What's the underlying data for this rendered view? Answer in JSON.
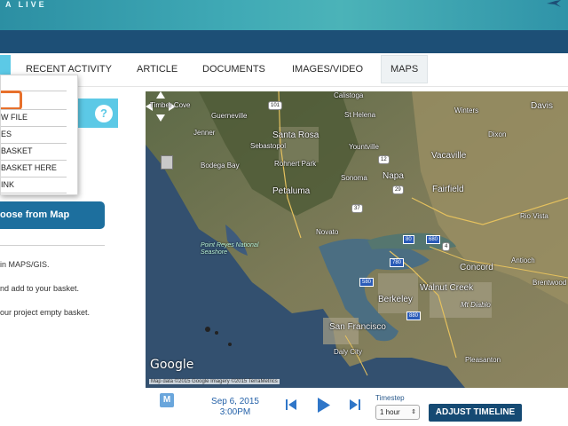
{
  "header": {
    "brand_text": "A LIVE",
    "colors": {
      "bar_start": "#2c8fa3",
      "bar_end": "#2f93a8",
      "band": "#1d4f76"
    }
  },
  "nav": {
    "tabs": [
      {
        "label": "RECENT ACTIVITY"
      },
      {
        "label": "ARTICLE"
      },
      {
        "label": "DOCUMENTS"
      },
      {
        "label": "IMAGES/VIDEO"
      },
      {
        "label": "MAPS",
        "active": true
      }
    ],
    "accent_color": "#5cc9e6"
  },
  "dropdown": {
    "items": [
      {
        "label": ""
      },
      {
        "label": "W FILE"
      },
      {
        "label": "ES"
      },
      {
        "label": "BASKET"
      },
      {
        "label": "BASKET HERE"
      },
      {
        "label": "INK"
      }
    ],
    "highlight_color": "#e7702b"
  },
  "left_panel": {
    "help_label": "?",
    "choose_button": "oose from Map",
    "info_lines": [
      "in MAPS/GIS.",
      "nd add to your basket.",
      "our project empty basket."
    ]
  },
  "map": {
    "places": [
      {
        "name": "Timber Cove"
      },
      {
        "name": "Calistoga"
      },
      {
        "name": "Guerneville"
      },
      {
        "name": "St Helena"
      },
      {
        "name": "Winters"
      },
      {
        "name": "Davis"
      },
      {
        "name": "Jenner"
      },
      {
        "name": "Santa Rosa"
      },
      {
        "name": "Sebastopol"
      },
      {
        "name": "Yountville"
      },
      {
        "name": "Vacaville"
      },
      {
        "name": "Dixon"
      },
      {
        "name": "Bodega Bay"
      },
      {
        "name": "Rohnert Park"
      },
      {
        "name": "Sonoma"
      },
      {
        "name": "Napa"
      },
      {
        "name": "Fairfield"
      },
      {
        "name": "Petaluma"
      },
      {
        "name": "Rio Vista"
      },
      {
        "name": "Novato"
      },
      {
        "name": "Point Reyes National Seashore"
      },
      {
        "name": "Concord"
      },
      {
        "name": "Antioch"
      },
      {
        "name": "Walnut Creek"
      },
      {
        "name": "Brentwood"
      },
      {
        "name": "Berkeley"
      },
      {
        "name": "Mt Diablo"
      },
      {
        "name": "San Francisco"
      },
      {
        "name": "Daly City"
      },
      {
        "name": "Pleasanton"
      }
    ],
    "routes": [
      "101",
      "29",
      "12",
      "37",
      "80",
      "780",
      "680",
      "580",
      "880",
      "4"
    ],
    "google_label": "Google",
    "attribution": "Map data ©2015 Google Imagery ©2015 TerraMetrics",
    "icons": [
      "pan-icon",
      "pegman-icon"
    ]
  },
  "timeline": {
    "m_label": "M",
    "date": "Sep 6, 2015",
    "time": "3:00PM",
    "timestep_label": "Timestep",
    "timestep_value": "1 hour",
    "adjust_button": "ADJUST TIMELINE",
    "icons": [
      "skip-back-icon",
      "play-icon",
      "skip-forward-icon"
    ],
    "control_color": "#2f76c8"
  }
}
